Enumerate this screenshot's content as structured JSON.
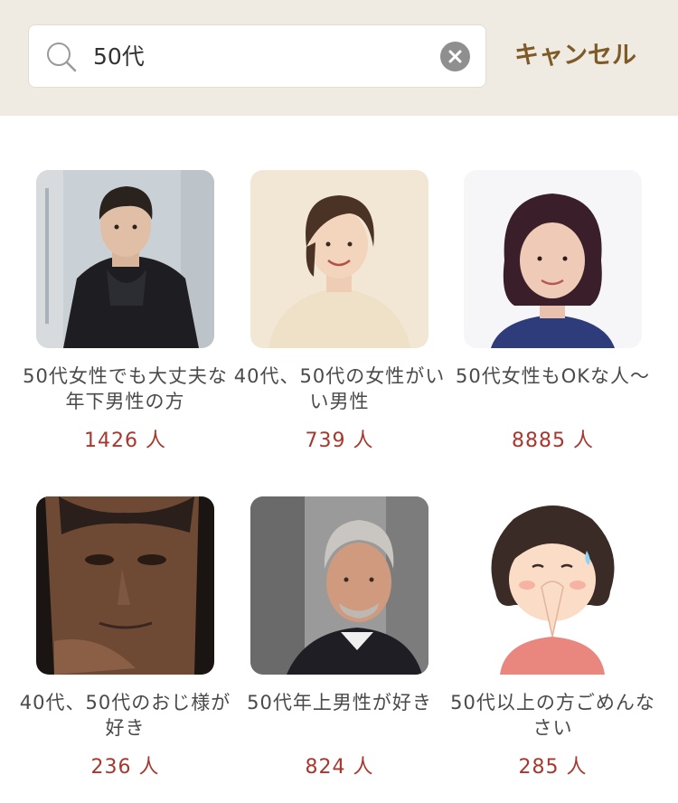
{
  "search": {
    "query": "50代",
    "cancel_label": "キャンセル"
  },
  "communities": [
    {
      "title": "50代女性でも大丈夫な年下男性の方",
      "count": "1426 人",
      "image": "young-man-photo"
    },
    {
      "title": "40代、50代の女性がいい男性",
      "count": "739 人",
      "image": "smiling-woman-photo"
    },
    {
      "title": "50代女性もOKな人〜",
      "count": "8885 人",
      "image": "bob-haired-woman-photo"
    },
    {
      "title": "40代、50代のおじ様が好き",
      "count": "236 人",
      "image": "older-man-photo"
    },
    {
      "title": "50代年上男性が好き",
      "count": "824 人",
      "image": "gray-haired-man-photo"
    },
    {
      "title": "50代以上の方ごめんなさい",
      "count": "285 人",
      "image": "apologizing-girl-illustration"
    }
  ],
  "colors": {
    "header_bg": "#efebe3",
    "accent_brown": "#7d5a26",
    "count_red": "#a8372e"
  }
}
